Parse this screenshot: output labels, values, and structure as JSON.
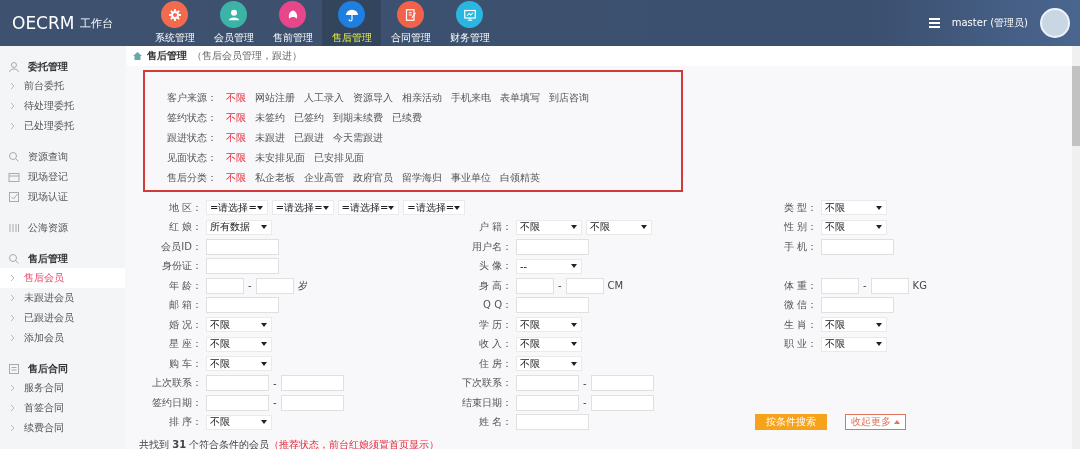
{
  "header": {
    "logo": "OECRM",
    "logo_suffix": "工作台",
    "modules": [
      {
        "label": "系统管理",
        "color": "#f26b4f",
        "selected": false
      },
      {
        "label": "会员管理",
        "color": "#3bb3a6",
        "selected": false
      },
      {
        "label": "售前管理",
        "color": "#e8468a",
        "selected": false
      },
      {
        "label": "售后管理",
        "color": "#1e7fe0",
        "selected": true
      },
      {
        "label": "合同管理",
        "color": "#f0634a",
        "selected": false
      },
      {
        "label": "财务管理",
        "color": "#29b6e0",
        "selected": false
      }
    ],
    "user": "master (管理员)"
  },
  "sidebar": {
    "entries": [
      {
        "kind": "group",
        "title": "委托管理",
        "items": [
          {
            "label": "前台委托",
            "selected": false
          },
          {
            "label": "待处理委托",
            "selected": false
          },
          {
            "label": "已处理委托",
            "selected": false
          }
        ]
      },
      {
        "kind": "links",
        "items": [
          {
            "label": "资源查询",
            "selected": false
          },
          {
            "label": "现场登记",
            "selected": false
          },
          {
            "label": "现场认证",
            "selected": false
          }
        ]
      },
      {
        "kind": "links",
        "items": [
          {
            "label": "公海资源",
            "selected": false
          }
        ]
      },
      {
        "kind": "group",
        "title": "售后管理",
        "items": [
          {
            "label": "售后会员",
            "selected": true
          },
          {
            "label": "未跟进会员",
            "selected": false
          },
          {
            "label": "已跟进会员",
            "selected": false
          },
          {
            "label": "添加会员",
            "selected": false
          }
        ]
      },
      {
        "kind": "group",
        "title": "售后合同",
        "items": [
          {
            "label": "服务合同",
            "selected": false
          },
          {
            "label": "首签合同",
            "selected": false
          },
          {
            "label": "续费合同",
            "selected": false
          }
        ]
      }
    ]
  },
  "breadcrumb": {
    "title": "售后管理",
    "subtitle": "（售后会员管理，跟进）"
  },
  "filters": [
    {
      "label": "客户来源：",
      "options": [
        {
          "label": "不限",
          "selected": true
        },
        {
          "label": "网站注册",
          "selected": false
        },
        {
          "label": "人工录入",
          "selected": false
        },
        {
          "label": "资源导入",
          "selected": false
        },
        {
          "label": "相亲活动",
          "selected": false
        },
        {
          "label": "手机来电",
          "selected": false
        },
        {
          "label": "表单填写",
          "selected": false
        },
        {
          "label": "到店咨询",
          "selected": false
        }
      ]
    },
    {
      "label": "签约状态：",
      "options": [
        {
          "label": "不限",
          "selected": true
        },
        {
          "label": "未签约",
          "selected": false
        },
        {
          "label": "已签约",
          "selected": false
        },
        {
          "label": "到期未续费",
          "selected": false
        },
        {
          "label": "已续费",
          "selected": false
        }
      ]
    },
    {
      "label": "跟进状态：",
      "options": [
        {
          "label": "不限",
          "selected": true
        },
        {
          "label": "未跟进",
          "selected": false
        },
        {
          "label": "已跟进",
          "selected": false
        },
        {
          "label": "今天需跟进",
          "selected": false
        }
      ]
    },
    {
      "label": "见面状态：",
      "options": [
        {
          "label": "不限",
          "selected": true
        },
        {
          "label": "未安排见面",
          "selected": false
        },
        {
          "label": "已安排见面",
          "selected": false
        }
      ]
    },
    {
      "label": "售后分类：",
      "options": [
        {
          "label": "不限",
          "selected": true
        },
        {
          "label": "私企老板",
          "selected": false
        },
        {
          "label": "企业高管",
          "selected": false
        },
        {
          "label": "政府官员",
          "selected": false
        },
        {
          "label": "留学海归",
          "selected": false
        },
        {
          "label": "事业单位",
          "selected": false
        },
        {
          "label": "白领精英",
          "selected": false
        }
      ]
    }
  ],
  "search_form": {
    "rows": [
      {
        "left": {
          "label": "地 区：",
          "controls": [
            {
              "kind": "select",
              "value": "=请选择="
            },
            {
              "kind": "select",
              "value": "=请选择="
            },
            {
              "kind": "select",
              "value": "=请选择="
            },
            {
              "kind": "select",
              "value": "=请选择="
            }
          ]
        },
        "right": {
          "label": "类 型：",
          "controls": [
            {
              "kind": "select",
              "value": "不限"
            }
          ]
        }
      },
      {
        "left": {
          "label": "红 娘：",
          "controls": [
            {
              "kind": "select",
              "value": "所有数据"
            }
          ]
        },
        "middle": {
          "label": "户 籍：",
          "controls": [
            {
              "kind": "select",
              "value": "不限"
            },
            {
              "kind": "select",
              "value": "不限"
            }
          ]
        },
        "right": {
          "label": "性 别：",
          "controls": [
            {
              "kind": "select",
              "value": "不限"
            }
          ]
        }
      },
      {
        "left": {
          "label": "会员ID：",
          "controls": [
            {
              "kind": "input"
            }
          ]
        },
        "middle": {
          "label": "用户名：",
          "controls": [
            {
              "kind": "input"
            }
          ]
        },
        "right": {
          "label": "手 机：",
          "controls": [
            {
              "kind": "input"
            }
          ]
        }
      },
      {
        "left": {
          "label": "身份证：",
          "controls": [
            {
              "kind": "input"
            }
          ]
        },
        "middle": {
          "label": "头 像：",
          "controls": [
            {
              "kind": "select",
              "value": "--"
            }
          ]
        }
      },
      {
        "left": {
          "label": "年 龄：",
          "controls": [
            {
              "kind": "short_input"
            },
            {
              "kind": "text",
              "text": "-"
            },
            {
              "kind": "short_input"
            },
            {
              "kind": "text",
              "text": "岁"
            }
          ]
        },
        "middle": {
          "label": "身 高：",
          "controls": [
            {
              "kind": "short_input"
            },
            {
              "kind": "text",
              "text": "-"
            },
            {
              "kind": "short_input"
            },
            {
              "kind": "text",
              "text": "CM"
            }
          ]
        },
        "right": {
          "label": "体 重：",
          "controls": [
            {
              "kind": "short_input"
            },
            {
              "kind": "text",
              "text": "-"
            },
            {
              "kind": "short_input"
            },
            {
              "kind": "text",
              "text": "KG"
            }
          ]
        }
      },
      {
        "left": {
          "label": "邮 箱：",
          "controls": [
            {
              "kind": "input"
            }
          ]
        },
        "middle": {
          "label": "Q Q：",
          "controls": [
            {
              "kind": "input"
            }
          ]
        },
        "right": {
          "label": "微 信：",
          "controls": [
            {
              "kind": "input"
            }
          ]
        }
      },
      {
        "left": {
          "label": "婚 况：",
          "controls": [
            {
              "kind": "select",
              "value": "不限"
            }
          ]
        },
        "middle": {
          "label": "学 历：",
          "controls": [
            {
              "kind": "select",
              "value": "不限"
            }
          ]
        },
        "right": {
          "label": "生 肖：",
          "controls": [
            {
              "kind": "select",
              "value": "不限"
            }
          ]
        }
      },
      {
        "left": {
          "label": "星 座：",
          "controls": [
            {
              "kind": "select",
              "value": "不限"
            }
          ]
        },
        "middle": {
          "label": "收 入：",
          "controls": [
            {
              "kind": "select",
              "value": "不限"
            }
          ]
        },
        "right": {
          "label": "职 业：",
          "controls": [
            {
              "kind": "select",
              "value": "不限"
            }
          ]
        }
      },
      {
        "left": {
          "label": "购 车：",
          "controls": [
            {
              "kind": "select",
              "value": "不限"
            }
          ]
        },
        "middle": {
          "label": "住 房：",
          "controls": [
            {
              "kind": "select",
              "value": "不限"
            }
          ]
        }
      },
      {
        "left": {
          "label": "上次联系：",
          "controls": [
            {
              "kind": "date_input"
            },
            {
              "kind": "text",
              "text": "-"
            },
            {
              "kind": "date_input"
            }
          ]
        },
        "middle": {
          "label": "下次联系：",
          "controls": [
            {
              "kind": "date_input"
            },
            {
              "kind": "text",
              "text": "-"
            },
            {
              "kind": "date_input"
            }
          ]
        }
      },
      {
        "left": {
          "label": "签约日期：",
          "controls": [
            {
              "kind": "date_input"
            },
            {
              "kind": "text",
              "text": "-"
            },
            {
              "kind": "date_input"
            }
          ]
        },
        "middle": {
          "label": "结束日期：",
          "controls": [
            {
              "kind": "date_input"
            },
            {
              "kind": "text",
              "text": "-"
            },
            {
              "kind": "date_input"
            }
          ]
        }
      },
      {
        "left": {
          "label": "排 序：",
          "controls": [
            {
              "kind": "select",
              "value": "不限"
            }
          ]
        },
        "middle": {
          "label": "姓 名：",
          "controls": [
            {
              "kind": "input"
            }
          ]
        }
      }
    ],
    "actions": [
      {
        "kind": "primary",
        "label": "按条件搜索"
      },
      {
        "kind": "outline",
        "label": "收起更多"
      }
    ]
  },
  "result": {
    "summary": "共找到 **31** 个符合条件的会员",
    "note": "（推荐状态，前台红娘须置首页显示）"
  }
}
